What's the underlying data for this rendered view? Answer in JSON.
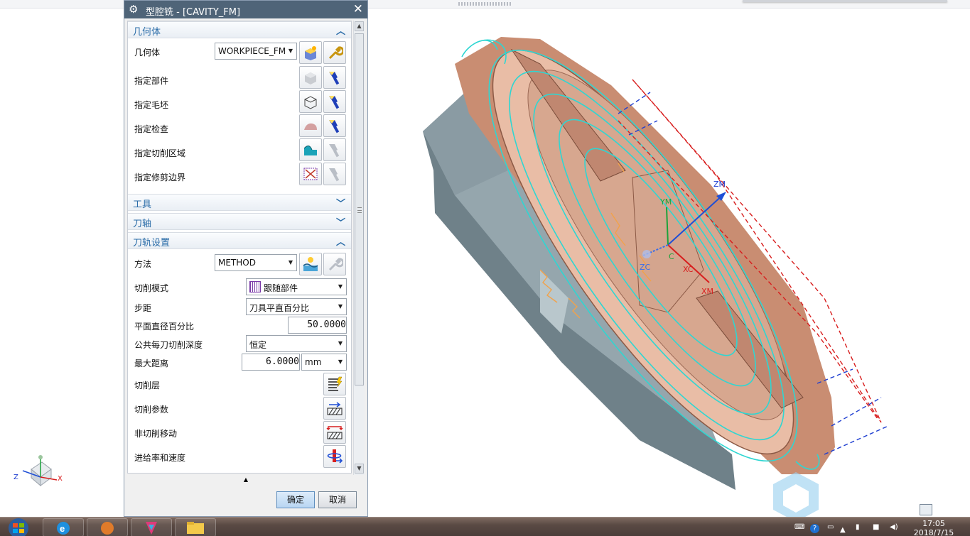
{
  "dialog": {
    "title": "型腔铣 - [CAVITY_FM]",
    "geometry": {
      "header": "几何体",
      "geometry_label": "几何体",
      "geometry_value": "WORKPIECE_FM",
      "specify_part": "指定部件",
      "specify_blank": "指定毛坯",
      "specify_check": "指定检查",
      "specify_cut_area": "指定切削区域",
      "specify_trim_boundary": "指定修剪边界"
    },
    "tool": {
      "header": "工具"
    },
    "axis": {
      "header": "刀轴"
    },
    "path": {
      "header": "刀轨设置",
      "method_label": "方法",
      "method_value": "METHOD",
      "cut_pattern_label": "切削模式",
      "cut_pattern_value": "跟随部件",
      "stepover_label": "步距",
      "stepover_value": "刀具平直百分比",
      "flat_diameter_label": "平面直径百分比",
      "flat_diameter_value": "50.0000",
      "depth_label": "公共每刀切削深度",
      "depth_value": "恒定",
      "max_distance_label": "最大距离",
      "max_distance_value": "6.0000",
      "max_distance_unit": "mm",
      "cut_levels": "切削层",
      "cut_params": "切削参数",
      "non_cut_moves": "非切削移动",
      "feeds_speeds": "进给率和速度"
    },
    "ok": "确定",
    "cancel": "取消"
  },
  "viewport": {
    "labels": {
      "zm": "ZM",
      "ym": "YM",
      "xm": "XM",
      "zc": "ZC",
      "xc": "XC",
      "c": "C"
    },
    "triad": {
      "z": "Z",
      "x": "X"
    }
  },
  "taskbar": {
    "time": "17:05",
    "date": "2018/7/15"
  },
  "colors": {
    "title_bar": "#4f6478",
    "section_text": "#2a6ca8",
    "part": "#d9a48a",
    "fixture": "#8d9ea6",
    "toolpath": "#2fd6d2",
    "accent_red": "#d81e1e",
    "accent_blue": "#1f3fd1"
  }
}
